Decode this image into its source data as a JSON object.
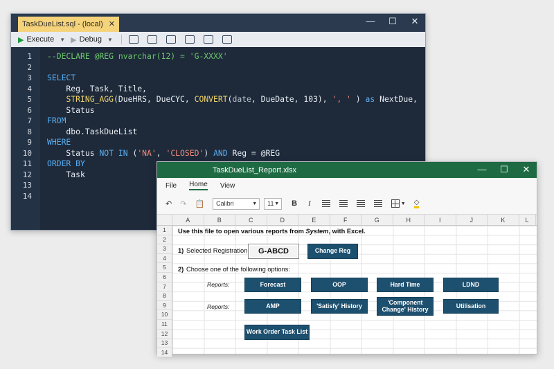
{
  "ssms": {
    "tab_title": "TaskDueList.sql - (local)",
    "tab_close": "✕",
    "toolbar": {
      "execute_label": "Execute",
      "debug_label": "Debug"
    },
    "line_numbers": [
      "1",
      "2",
      "3",
      "4",
      "5",
      "6",
      "7",
      "8",
      "9",
      "10",
      "11",
      "12",
      "13",
      "14"
    ]
  },
  "window_controls": {
    "minimize": "—",
    "maximize": "☐",
    "close": "✕"
  },
  "excel": {
    "title": "TaskDueList_Report.xlsx",
    "menu": {
      "file": "File",
      "home": "Home",
      "view": "View"
    },
    "ribbon": {
      "font": "Calibri",
      "size": "11",
      "bold": "B",
      "italic": "I"
    },
    "columns": [
      "A",
      "B",
      "C",
      "D",
      "E",
      "F",
      "G",
      "H",
      "I",
      "J",
      "K",
      "L"
    ],
    "rows": [
      "1",
      "2",
      "3",
      "4",
      "5",
      "6",
      "7",
      "8",
      "9",
      "10",
      "11",
      "12",
      "13",
      "14"
    ],
    "intro_pre": "Use this file to open various reports from ",
    "intro_system": "System",
    "intro_post": ", with Excel.",
    "step1_num": "1)",
    "step1_label": "Selected Registration :",
    "registration_value": "G-ABCD",
    "change_reg_label": "Change Reg",
    "step2_num": "2)",
    "step2_label": "Choose one of the following options:",
    "reports_label_1": "Reports:",
    "reports_label_2": "Reports:",
    "buttons": {
      "forecast": "Forecast",
      "oop": "OOP",
      "hard_time": "Hard Time",
      "ldnd": "LDND",
      "amp": "AMP",
      "satisfy": "'Satisfy' History",
      "component_change": "'Component Change' History",
      "utilisation": "Utilisation",
      "work_order": "Work Order Task List"
    }
  }
}
